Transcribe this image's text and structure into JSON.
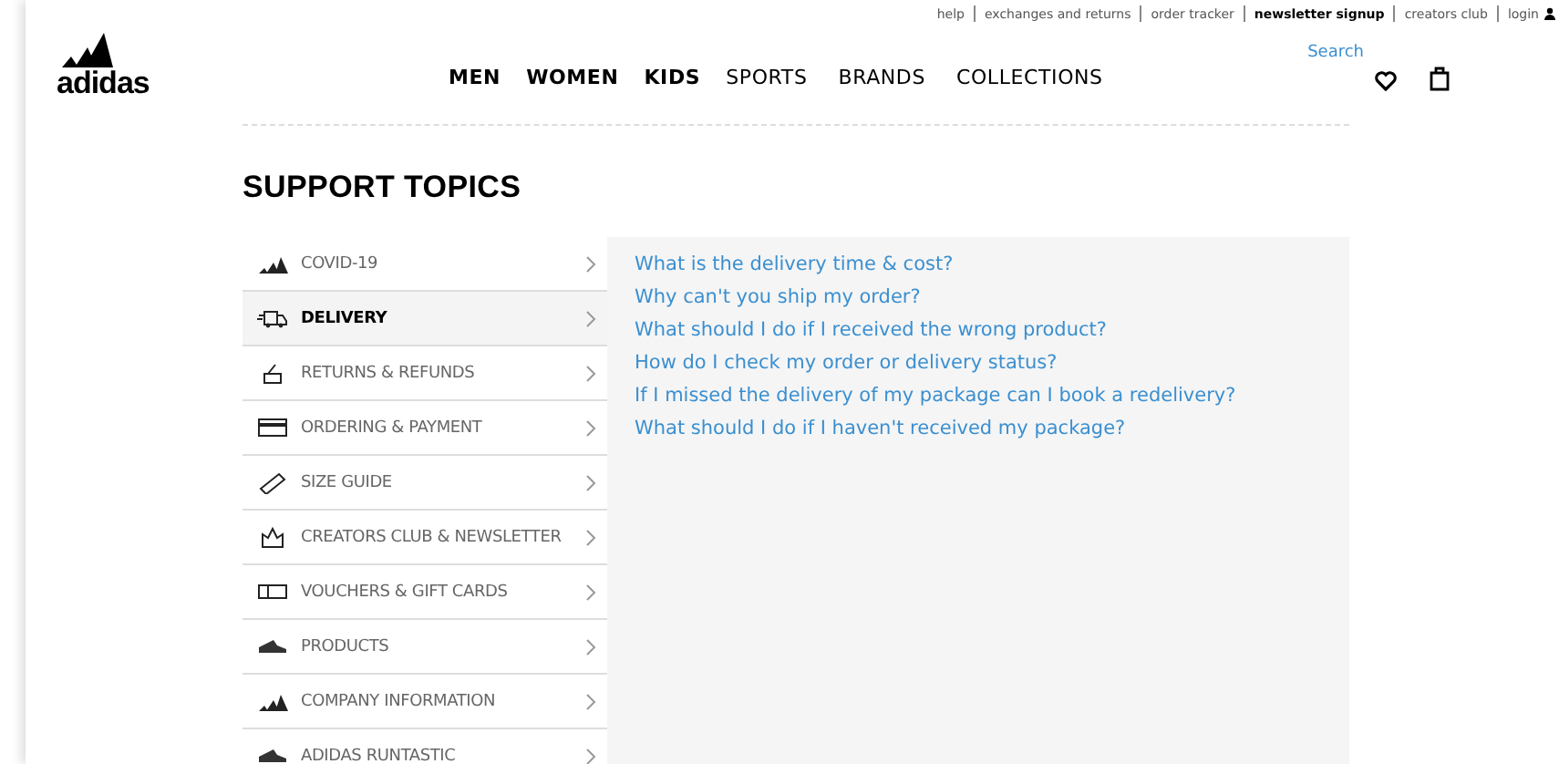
{
  "logo": {
    "wordmark": "adidas"
  },
  "utility_links": [
    {
      "label": "help",
      "bold": false
    },
    {
      "label": "exchanges and returns",
      "bold": false
    },
    {
      "label": "order tracker",
      "bold": false
    },
    {
      "label": "newsletter signup",
      "bold": true
    },
    {
      "label": "creators club",
      "bold": false
    },
    {
      "label": "login",
      "bold": false
    }
  ],
  "nav": [
    {
      "label": "MEN",
      "bold": true
    },
    {
      "label": "WOMEN",
      "bold": true
    },
    {
      "label": "KIDS",
      "bold": true
    },
    {
      "label": "SPORTS",
      "bold": false
    },
    {
      "label": "BRANDS",
      "bold": false
    },
    {
      "label": "COLLECTIONS",
      "bold": false
    }
  ],
  "search": {
    "label": "Search"
  },
  "heading": "SUPPORT TOPICS",
  "topics": [
    {
      "label": "COVID-19",
      "kind": "logo",
      "selected": false
    },
    {
      "label": "DELIVERY",
      "kind": "truck",
      "selected": true
    },
    {
      "label": "RETURNS & REFUNDS",
      "kind": "return",
      "selected": false
    },
    {
      "label": "ORDERING & PAYMENT",
      "kind": "card",
      "selected": false
    },
    {
      "label": "SIZE GUIDE",
      "kind": "ruler",
      "selected": false
    },
    {
      "label": "CREATORS CLUB & NEWSLETTER",
      "kind": "crown",
      "selected": false
    },
    {
      "label": "VOUCHERS & GIFT CARDS",
      "kind": "voucher",
      "selected": false
    },
    {
      "label": "PRODUCTS",
      "kind": "shoe",
      "selected": false
    },
    {
      "label": "COMPANY INFORMATION",
      "kind": "logo",
      "selected": false
    },
    {
      "label": "ADIDAS RUNTASTIC",
      "kind": "shoe",
      "selected": false
    }
  ],
  "questions": [
    "What is the delivery time & cost?",
    "Why can't you ship my order?",
    "What should I do if I received the wrong product?",
    "How do I check my order or delivery status?",
    "If I missed the delivery of my package can I book a redelivery?",
    "What should I do if I haven't received my package?"
  ]
}
